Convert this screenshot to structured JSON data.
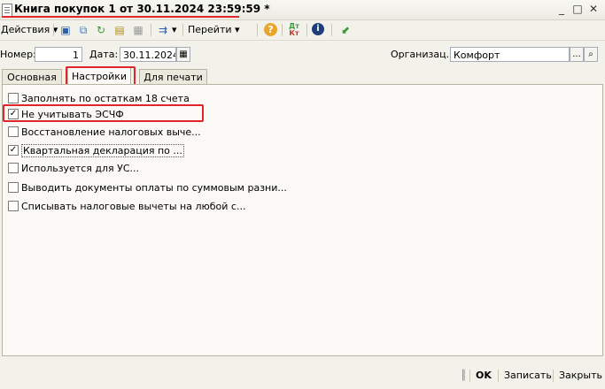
{
  "window": {
    "title": "Книга покупок  1 от 30.11.2024 23:59:59 *",
    "minimize": "_",
    "maximize": "□",
    "close": "✕"
  },
  "toolbar": {
    "actions_label": "Действия",
    "goto_label": "Перейти",
    "dropdown_arrow": "▾",
    "icons": [
      "save-icon",
      "copy-icon",
      "refresh-icon",
      "documents-icon",
      "delete-icon",
      "move-icon",
      "help-icon",
      "debit-credit-icon",
      "info-icon",
      "export-icon"
    ]
  },
  "header": {
    "number_label": "Номер:",
    "number_value": "1",
    "date_label": "Дата:",
    "date_value": "30.11.2024",
    "org_label": "Организац...",
    "org_value": "Комфорт",
    "org_select": "...",
    "org_search": "🔍"
  },
  "tabs": [
    {
      "label": "Основная"
    },
    {
      "label": "Настройки"
    },
    {
      "label": "Для печати"
    }
  ],
  "settings": [
    {
      "label": "Заполнять по остаткам 18 счета",
      "checked": false
    },
    {
      "label": "Не учитывать ЭСЧФ",
      "checked": true
    },
    {
      "label": "Восстановление налоговых выче...",
      "checked": false
    },
    {
      "label": "Квартальная декларация по ...",
      "checked": true
    },
    {
      "label": "Используется для УС...",
      "checked": false
    },
    {
      "label": "Выводить документы оплаты по суммовым разни...",
      "checked": false
    },
    {
      "label": "Списывать налоговые вычеты на любой с...",
      "checked": false
    }
  ],
  "footer": {
    "ok_label": "OK",
    "save_label": "Записать",
    "close_label": "Закрыть"
  },
  "colors": {
    "highlight": "#e0262a"
  }
}
